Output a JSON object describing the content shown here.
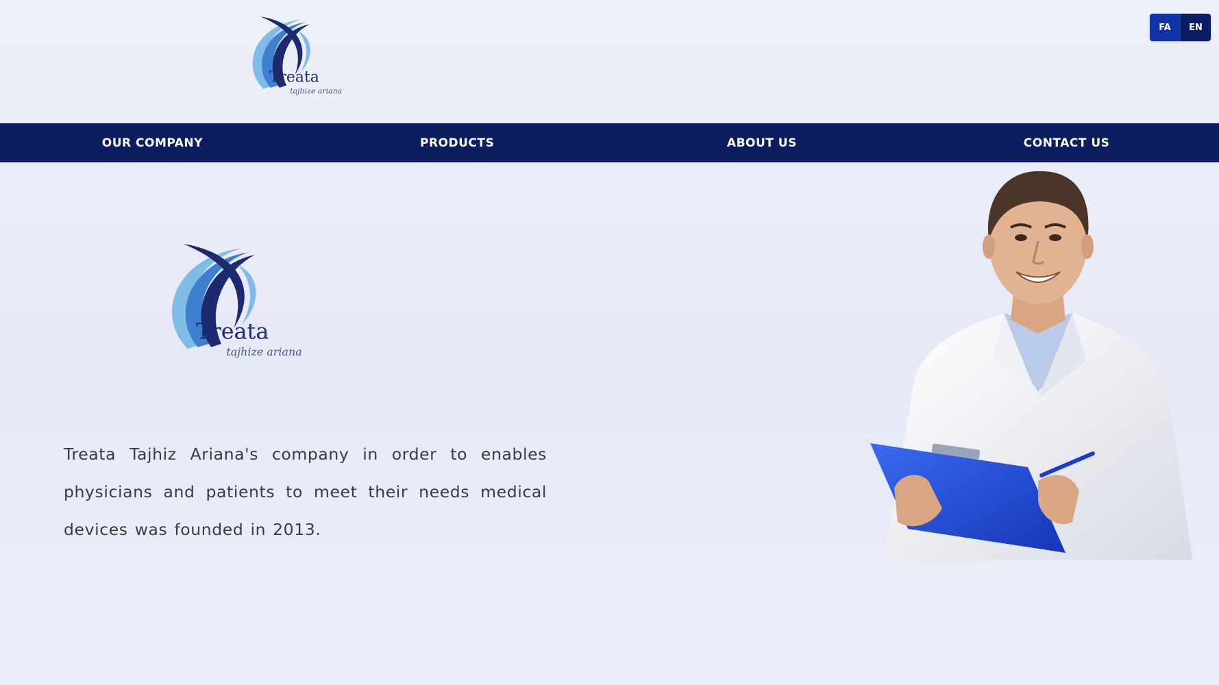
{
  "header": {
    "logo": {
      "name": "Treata",
      "subtitle": "tajhize ariana"
    },
    "language": {
      "fa_label": "FA",
      "en_label": "EN"
    }
  },
  "nav": {
    "items": [
      {
        "label": "OUR COMPANY"
      },
      {
        "label": "PRODUCTS"
      },
      {
        "label": "ABOUT US"
      },
      {
        "label": "CONTACT US"
      }
    ]
  },
  "main": {
    "logo": {
      "name": "Treata",
      "subtitle": "tajhize ariana"
    },
    "intro_text": "Treata Tajhiz Ariana's company in order to enables physicians and patients to meet their needs medical devices was founded in 2013.",
    "image": "doctor-with-clipboard"
  },
  "colors": {
    "nav_background": "#0c1d60",
    "brand_dark": "#1d2a6e",
    "brand_light": "#4e93d8",
    "lang_fa": "#1034a6",
    "lang_en": "#0b1d62"
  }
}
